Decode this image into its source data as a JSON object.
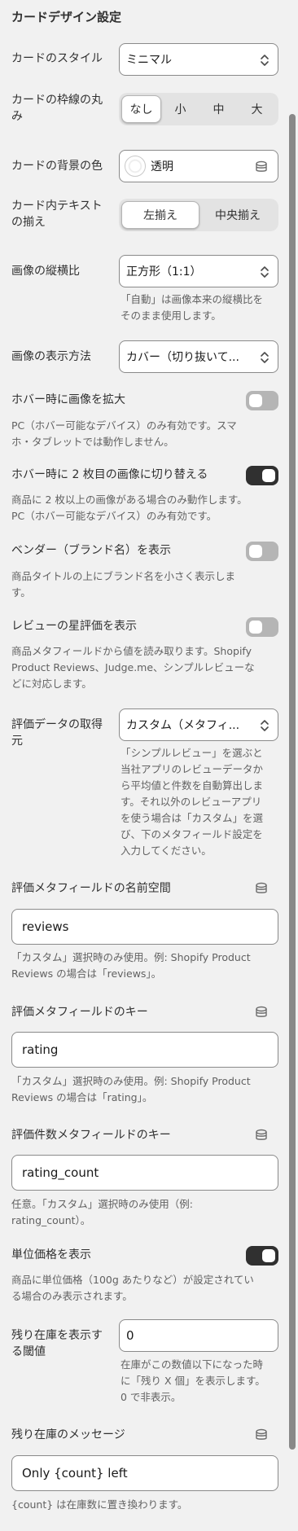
{
  "section_title": "カードデザイン設定",
  "card_style": {
    "label": "カードのスタイル",
    "value": "ミニマル"
  },
  "corner_radius": {
    "label_l1": "カードの枠線の丸",
    "label_l2": "み",
    "options": [
      "なし",
      "小",
      "中",
      "大"
    ],
    "selected": "なし"
  },
  "background_color": {
    "label": "カードの背景の色",
    "value": "透明"
  },
  "text_align": {
    "label_l1": "カード内テキスト",
    "label_l2": "の揃え",
    "options": [
      "左揃え",
      "中央揃え"
    ],
    "selected": "左揃え"
  },
  "aspect_ratio": {
    "label": "画像の縦横比",
    "value": "正方形（1:1）",
    "help_l1": "「自動」は画像本来の縦横比を",
    "help_l2": "そのまま使用します。"
  },
  "image_fit": {
    "label": "画像の表示方法",
    "value": "カバー（切り抜いて..."
  },
  "hover_zoom": {
    "label": "ホバー時に画像を拡大",
    "on": false,
    "help_l1": "PC（ホバー可能なデバイス）のみ有効です。スマ",
    "help_l2": "ホ・タブレットでは動作しません。"
  },
  "hover_second": {
    "label": "ホバー時に 2 枚目の画像に切り替える",
    "on": true,
    "help_l1": "商品に 2 枚以上の画像がある場合のみ動作します。",
    "help_l2": "PC（ホバー可能なデバイス）のみ有効です。"
  },
  "vendor": {
    "label": "ベンダー（ブランド名）を表示",
    "on": false,
    "help_l1": "商品タイトルの上にブランド名を小さく表示しま",
    "help_l2": "す。"
  },
  "review_stars": {
    "label": "レビューの星評価を表示",
    "on": false,
    "help_l1": "商品メタフィールドから値を読み取ります。Shopify",
    "help_l2": "Product Reviews、Judge.me、シンプルレビューな",
    "help_l3": "どに対応します。"
  },
  "rating_source": {
    "label_l1": "評価データの取得",
    "label_l2": "元",
    "value": "カスタム（メタフィ...",
    "help_lines": [
      "「シンプルレビュー」を選ぶと",
      "当社アプリのレビューデータか",
      "ら平均値と件数を自動算出しま",
      "す。それ以外のレビューアプリ",
      "を使う場合は「カスタム」を選",
      "び、下のメタフィールド設定を",
      "入力してください。"
    ]
  },
  "rating_namespace": {
    "label": "評価メタフィールドの名前空間",
    "value": "reviews",
    "help_l1": "「カスタム」選択時のみ使用。例: Shopify Product",
    "help_l2": "Reviews の場合は「reviews」。"
  },
  "rating_key": {
    "label": "評価メタフィールドのキー",
    "value": "rating",
    "help_l1": "「カスタム」選択時のみ使用。例: Shopify Product",
    "help_l2": "Reviews の場合は「rating」。"
  },
  "rating_count_key": {
    "label": "評価件数メタフィールドのキー",
    "value": "rating_count",
    "help_l1": "任意。「カスタム」選択時のみ使用（例:",
    "help_l2": "rating_count）。"
  },
  "unit_price": {
    "label": "単位価格を表示",
    "on": true,
    "help_l1": "商品に単位価格（100g あたりなど）が設定されてい",
    "help_l2": "る場合のみ表示されます。"
  },
  "low_stock": {
    "label_l1": "残り在庫を表示す",
    "label_l2": "る閾値",
    "value": "0",
    "help_l1": "在庫がこの数値以下になった時",
    "help_l2": "に「残り X 個」を表示します。",
    "help_l3": "0 で非表示。"
  },
  "low_stock_message": {
    "label": "残り在庫のメッセージ",
    "value": "Only {count} left",
    "help": "{count} は在庫数に置き換わります。"
  }
}
